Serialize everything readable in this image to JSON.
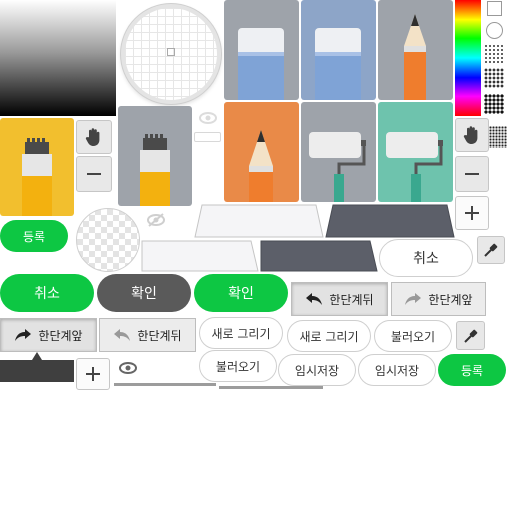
{
  "buttons": {
    "register": "등록",
    "cancel": "취소",
    "confirm": "확인",
    "undo": "한단계뒤",
    "redo": "한단계앞",
    "new_drawing": "새로 그리기",
    "load": "불러오기",
    "temp_save": "임시저장"
  },
  "icons": {
    "hand": "hand-icon",
    "minus": "minus-icon",
    "plus": "plus-icon",
    "eye": "eye-icon",
    "eye_off": "eye-off-icon",
    "eyedropper": "eyedropper-icon",
    "undo": "undo-arrow-icon",
    "redo": "redo-arrow-icon",
    "eraser": "eraser-icon",
    "pencil": "pencil-icon",
    "marker": "marker-icon",
    "roller": "paint-roller-icon"
  },
  "colors": {
    "accent_green": "#0dc743",
    "dark_button": "#5a5a5a",
    "tile_gray": "#9ea3aa",
    "tile_blue": "#8da5c8",
    "tile_orange": "#e98a48",
    "tile_teal": "#6ec3ad",
    "tile_yellow": "#f2bf2e",
    "eraser_blue": "#7fa3d6",
    "pencil_orange": "#ef7d2d",
    "marker_yellow": "#f3b10f"
  }
}
